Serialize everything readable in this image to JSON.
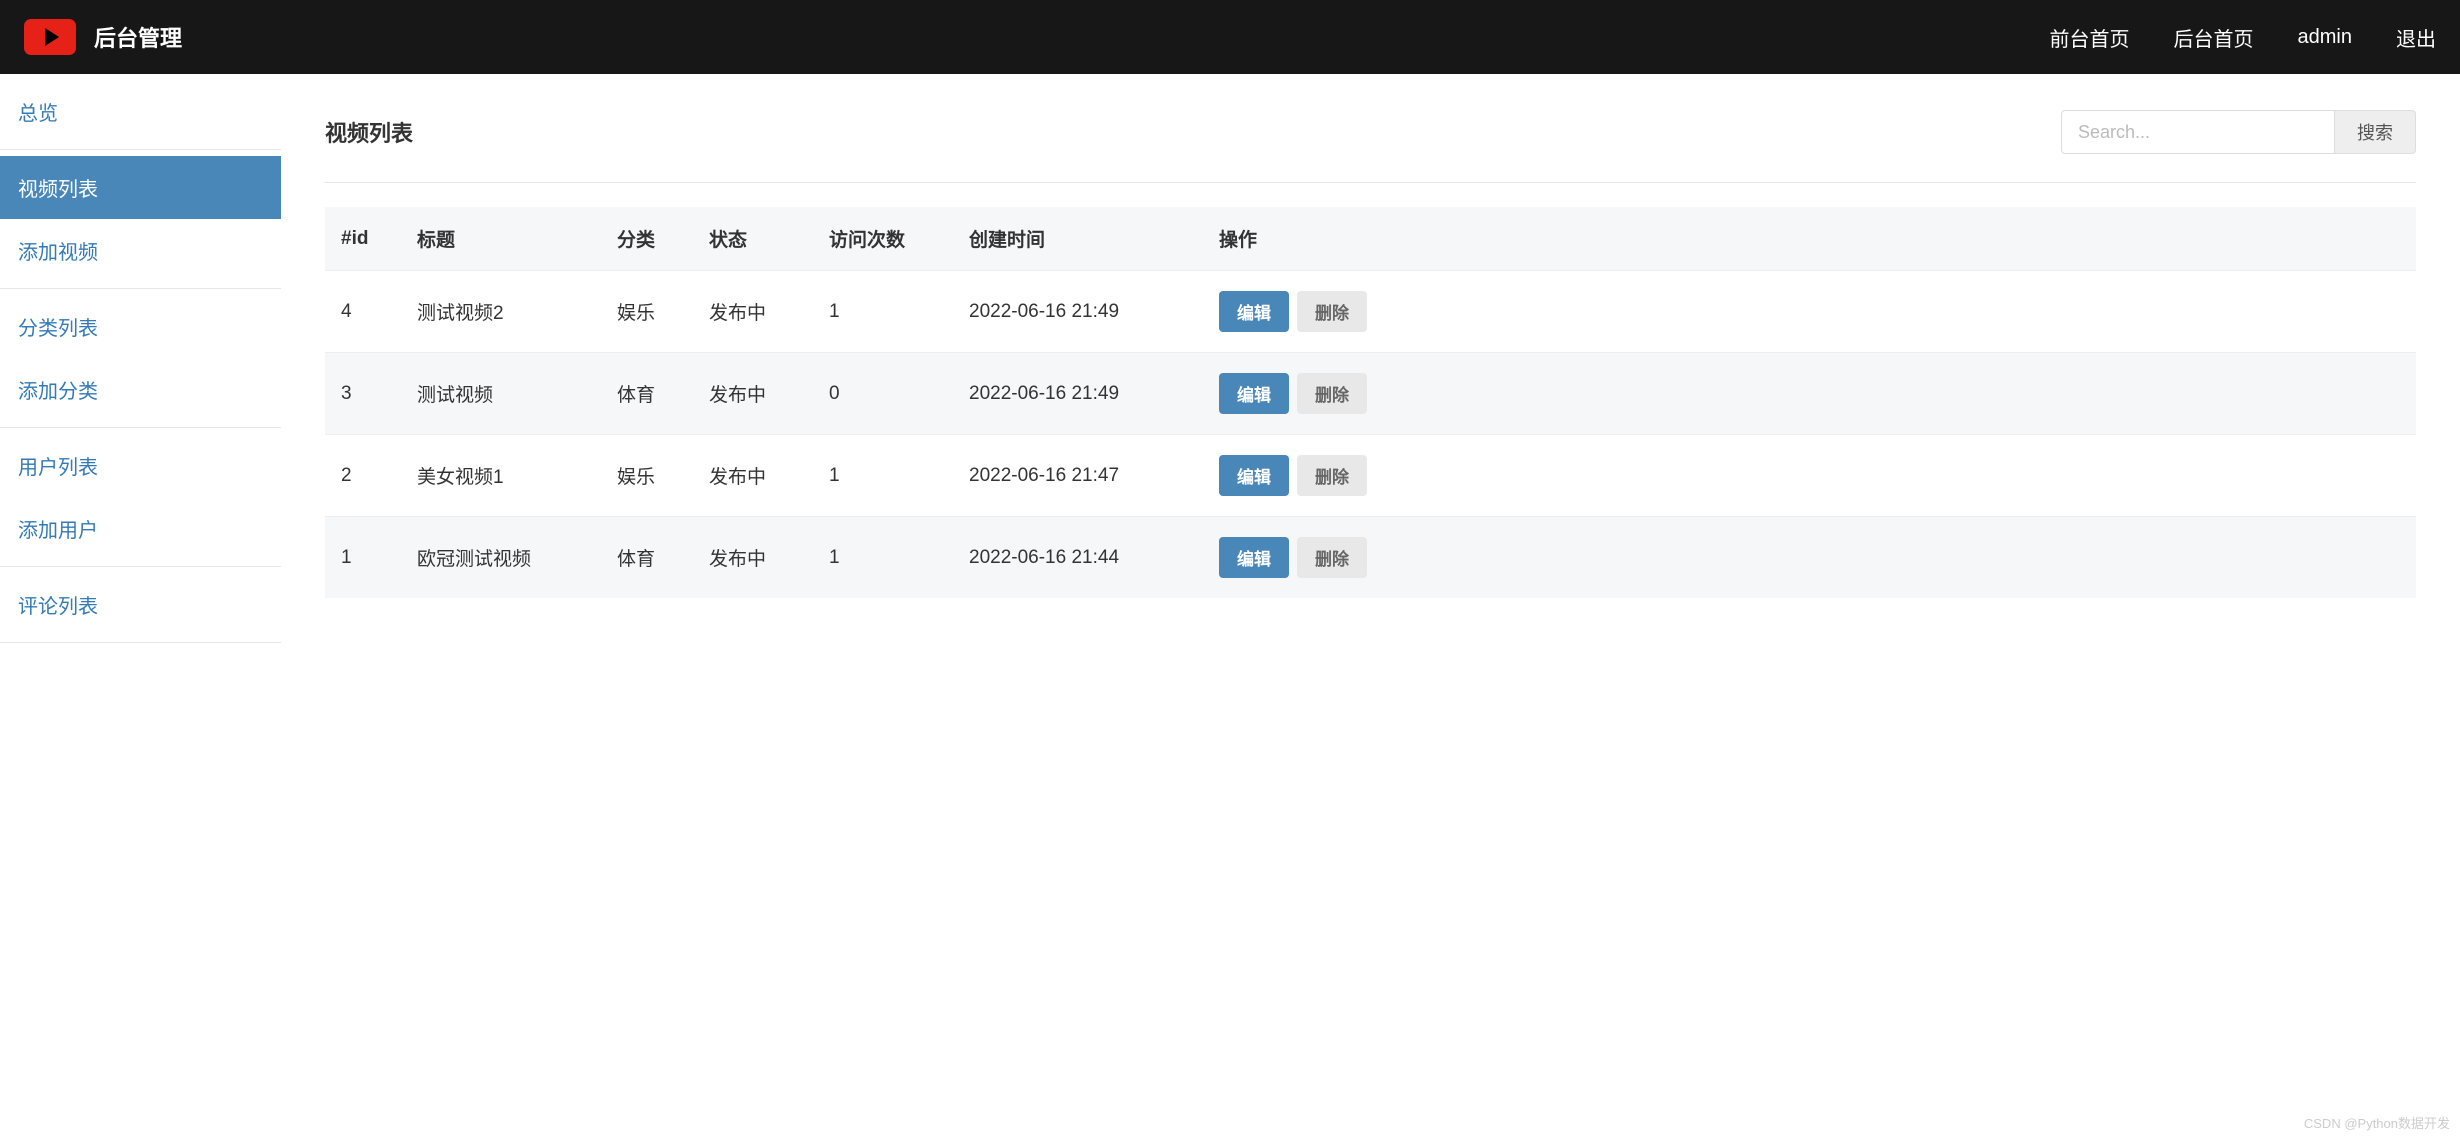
{
  "header": {
    "brand": "后台管理",
    "nav": {
      "front": "前台首页",
      "back": "后台首页",
      "user": "admin",
      "logout": "退出"
    }
  },
  "sidebar": {
    "groups": [
      {
        "items": [
          {
            "label": "总览",
            "active": false
          }
        ]
      },
      {
        "items": [
          {
            "label": "视频列表",
            "active": true
          },
          {
            "label": "添加视频",
            "active": false
          }
        ]
      },
      {
        "items": [
          {
            "label": "分类列表",
            "active": false
          },
          {
            "label": "添加分类",
            "active": false
          }
        ]
      },
      {
        "items": [
          {
            "label": "用户列表",
            "active": false
          },
          {
            "label": "添加用户",
            "active": false
          }
        ]
      },
      {
        "items": [
          {
            "label": "评论列表",
            "active": false
          }
        ]
      }
    ]
  },
  "page": {
    "title": "视频列表",
    "search_placeholder": "Search...",
    "search_button": "搜索"
  },
  "table": {
    "headers": {
      "id": "#id",
      "title": "标题",
      "category": "分类",
      "status": "状态",
      "views": "访问次数",
      "created": "创建时间",
      "actions": "操作"
    },
    "rows": [
      {
        "id": "4",
        "title": "测试视频2",
        "category": "娱乐",
        "status": "发布中",
        "views": "1",
        "created": "2022-06-16 21:49"
      },
      {
        "id": "3",
        "title": "测试视频",
        "category": "体育",
        "status": "发布中",
        "views": "0",
        "created": "2022-06-16 21:49"
      },
      {
        "id": "2",
        "title": "美女视频1",
        "category": "娱乐",
        "status": "发布中",
        "views": "1",
        "created": "2022-06-16 21:47"
      },
      {
        "id": "1",
        "title": "欧冠测试视频",
        "category": "体育",
        "status": "发布中",
        "views": "1",
        "created": "2022-06-16 21:44"
      }
    ],
    "actions": {
      "edit": "编辑",
      "delete": "删除"
    }
  },
  "watermark": "CSDN @Python数据开发"
}
